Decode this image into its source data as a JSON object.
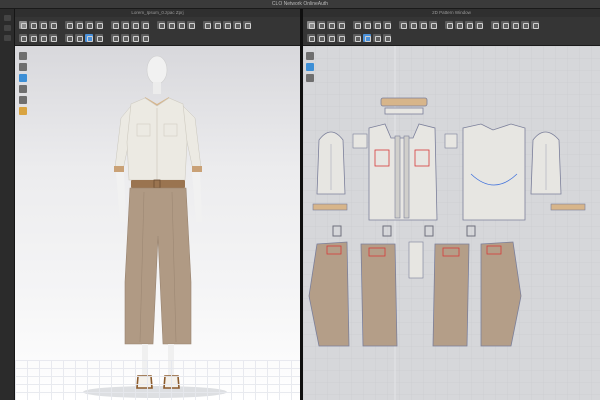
{
  "window": {
    "title": "CLO Network OnlineAuth"
  },
  "panel3d": {
    "title": "Lorem_Ipsum_0.zpac Zprj",
    "colors": {
      "shirt": "#eceae3",
      "pants": "#b09a84",
      "belt": "#9a7450",
      "skin": "#f0f0f0"
    }
  },
  "panel2d": {
    "title": "2D Pattern Window",
    "colors": {
      "pattern_fill_light": "#e7e6e2",
      "pattern_fill_pants": "#b49e88",
      "pattern_outline": "#7b7f9a",
      "seam_red": "#d63a3a",
      "selected_blue": "#3d6fdb"
    }
  },
  "icons": {
    "toolbar": [
      "select-icon",
      "transform-icon",
      "fold-icon",
      "sewing-icon",
      "fitting-icon",
      "avatar-icon",
      "fabric-icon",
      "render-icon",
      "measure-icon",
      "pin-icon",
      "zoom-icon",
      "settings-icon"
    ]
  }
}
